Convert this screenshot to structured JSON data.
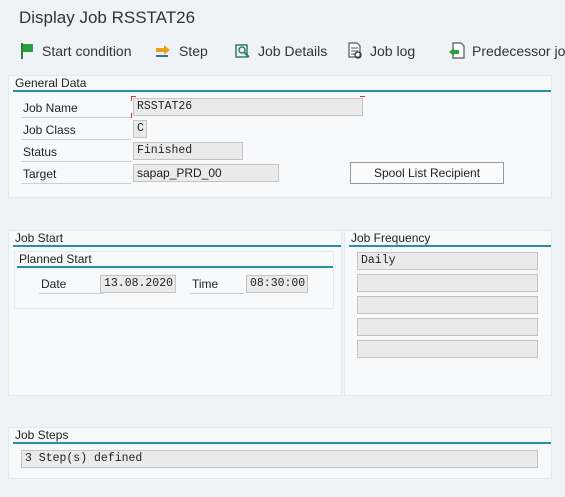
{
  "window": {
    "title": "Display Job RSSTAT26"
  },
  "toolbar": {
    "start_condition": "Start condition",
    "step": "Step",
    "job_details": "Job Details",
    "job_log": "Job log",
    "predecessor_job": "Predecessor job"
  },
  "general_data": {
    "heading": "General Data",
    "job_name_label": "Job Name",
    "job_name_value": "RSSTAT26",
    "job_class_label": "Job Class",
    "job_class_value": "C",
    "status_label": "Status",
    "status_value": "Finished",
    "target_label": "Target",
    "target_value": "sapap_PRD_00",
    "spool_button": "Spool List Recipient"
  },
  "job_start": {
    "heading": "Job Start",
    "planned_heading": "Planned Start",
    "date_label": "Date",
    "date_value": "13.08.2020",
    "time_label": "Time",
    "time_value": "08:30:00"
  },
  "job_frequency": {
    "heading": "Job Frequency",
    "rows": [
      "Daily",
      "",
      "",
      "",
      ""
    ]
  },
  "job_steps": {
    "heading": "Job Steps",
    "summary": "3 Step(s) defined"
  },
  "icons": {
    "start_condition": "flag-icon",
    "step": "step-arrow-icon",
    "job_details": "details-icon",
    "job_log": "log-icon",
    "predecessor_job": "predecessor-icon"
  },
  "colors": {
    "accent": "#2a8fa6",
    "flag": "#2e9e3e",
    "required_marker": "#c0392b"
  }
}
